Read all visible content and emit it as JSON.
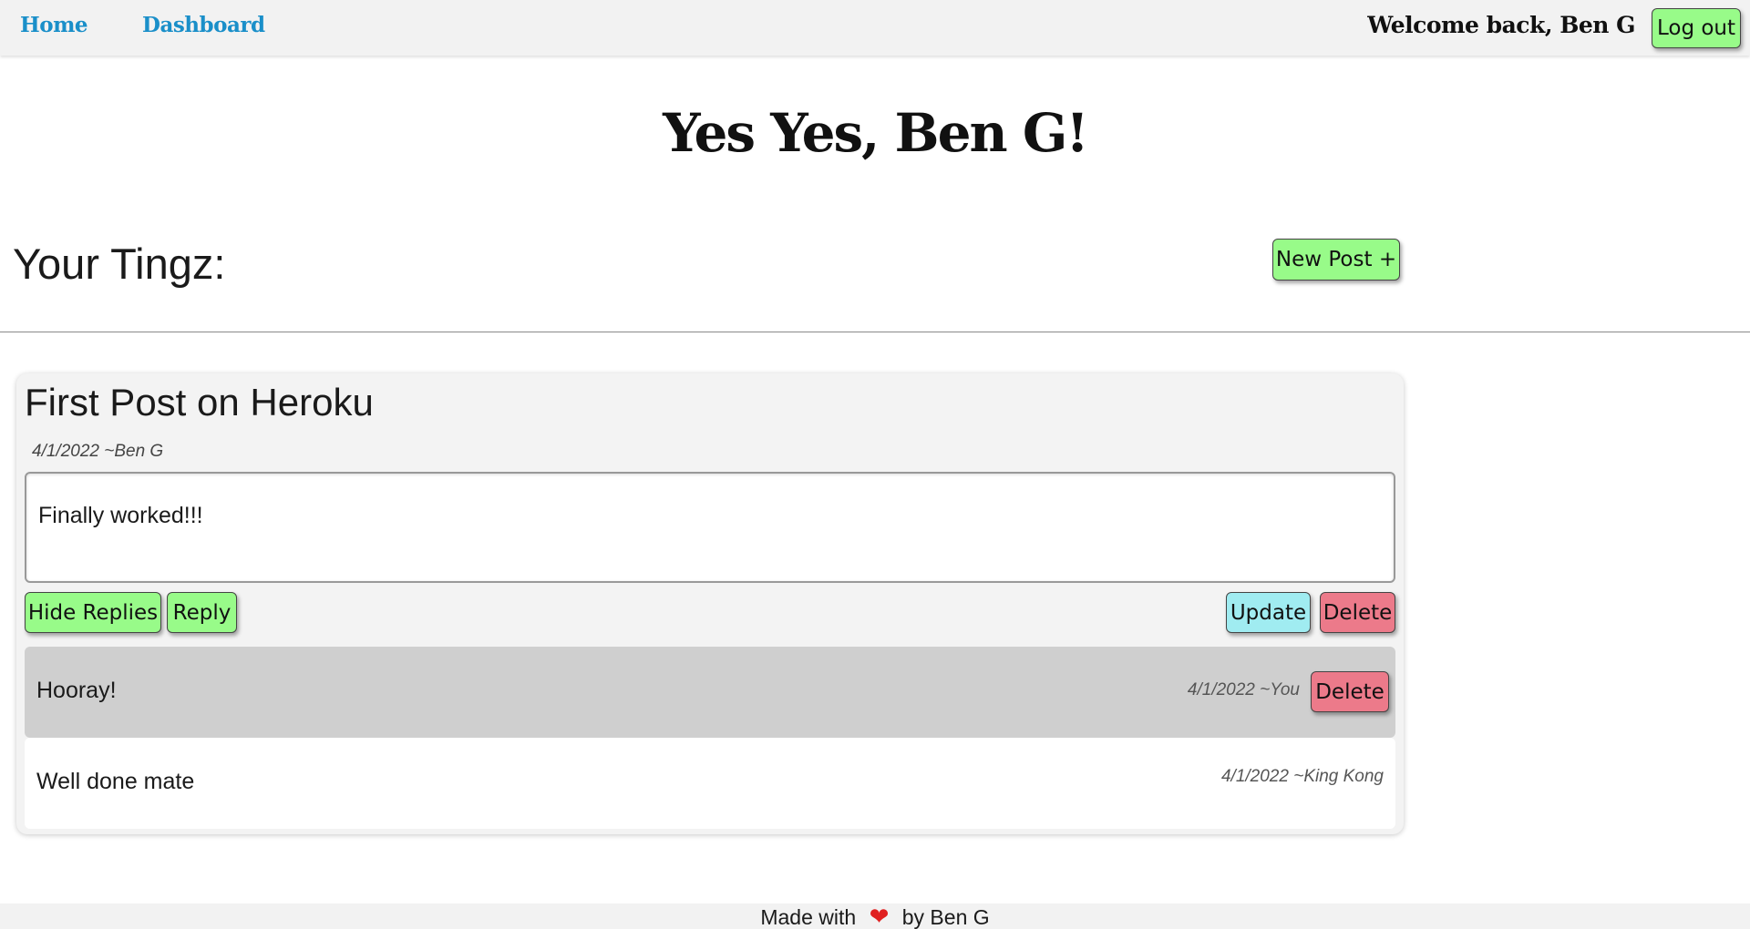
{
  "nav": {
    "home": "Home",
    "dashboard": "Dashboard",
    "welcome": "Welcome back, Ben G",
    "logout": "Log out"
  },
  "hero": {
    "title": "Yes Yes, Ben G!"
  },
  "section": {
    "title": "Your Tingz:",
    "new_post": "New Post +"
  },
  "post": {
    "title": "First Post on Heroku",
    "meta": "4/1/2022 ~Ben G",
    "body": "Finally worked!!!",
    "actions": {
      "hide_replies": "Hide Replies",
      "reply": "Reply",
      "update": "Update",
      "delete": "Delete"
    },
    "replies": [
      {
        "text": "Hooray!",
        "meta": "4/1/2022 ~You",
        "delete": "Delete"
      },
      {
        "text": "Well done mate",
        "meta": "4/1/2022 ~King Kong"
      }
    ]
  },
  "footer": {
    "made_with": "Made with",
    "heart_icon": "heart-icon",
    "by": "by Ben G"
  },
  "colors": {
    "nav_link": "#1a8fc9",
    "green_button": "#98fb89",
    "update_button": "#a0ecf1",
    "delete_button": "#ec7a8a",
    "heart": "#e02020"
  }
}
